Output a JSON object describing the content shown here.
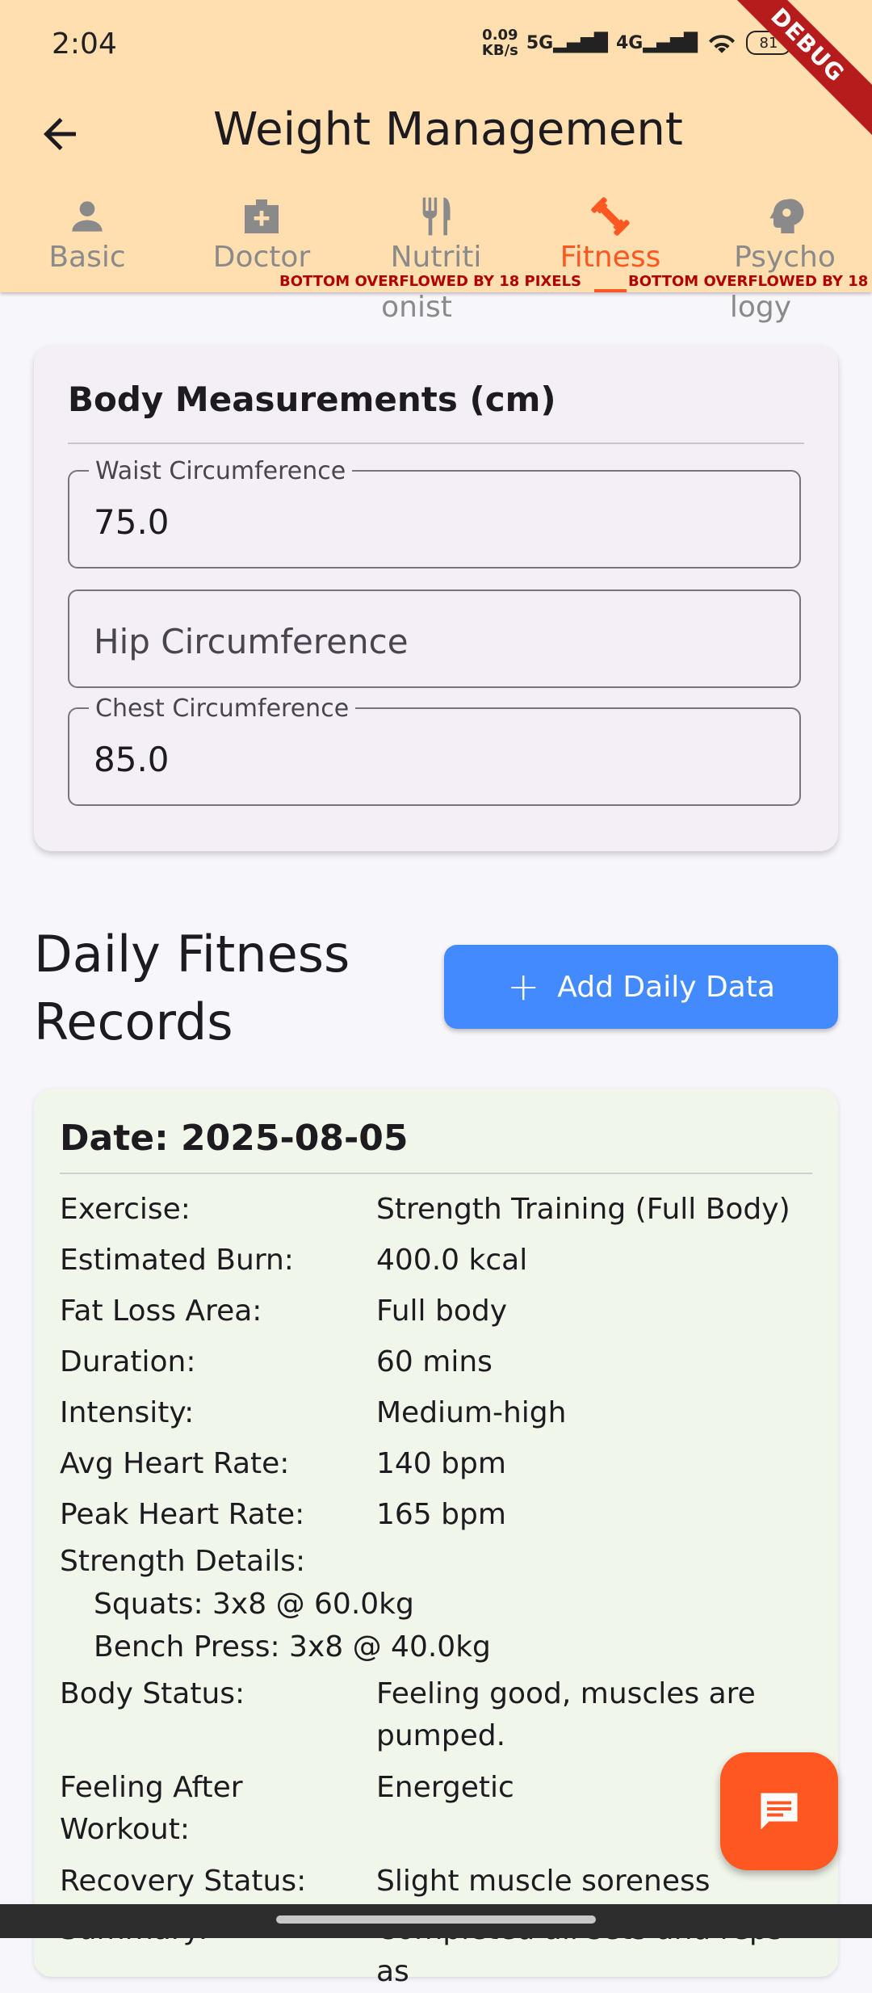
{
  "status": {
    "time": "2:04",
    "speed_top": "0.09",
    "speed_bottom": "KB/s",
    "net1": "5G",
    "net2": "4G",
    "battery": "81",
    "debug": "DEBUG"
  },
  "appbar": {
    "title": "Weight Management"
  },
  "tabs": [
    {
      "label": "Basic",
      "icon": "person-icon"
    },
    {
      "label": "Doctor",
      "icon": "medical-bag-icon"
    },
    {
      "label": "Nutriti",
      "label2": "onist",
      "icon": "fork-knife-icon"
    },
    {
      "label": "Fitness",
      "icon": "dumbbell-icon"
    },
    {
      "label": "Psycho",
      "label2": "logy",
      "icon": "head-gear-icon"
    }
  ],
  "overflow": {
    "text1": "BOTTOM OVERFLOWED BY 18 PIXELS",
    "text2": "BOTTOM OVERFLOWED BY 18"
  },
  "body_card": {
    "title": "Body Measurements (cm)",
    "waist_label": "Waist Circumference",
    "waist_value": "75.0",
    "hip_placeholder": "Hip Circumference",
    "chest_label": "Chest Circumference",
    "chest_value": "85.0"
  },
  "daily": {
    "title_line1": "Daily Fitness",
    "title_line2": "Records",
    "add_button": "Add Daily Data"
  },
  "record": {
    "date": "Date: 2025-08-05",
    "rows": [
      {
        "label": "Exercise:",
        "value": "Strength Training (Full Body)"
      },
      {
        "label": "Estimated Burn:",
        "value": "400.0 kcal"
      },
      {
        "label": "Fat Loss Area:",
        "value": "Full body"
      },
      {
        "label": "Duration:",
        "value": "60 mins"
      },
      {
        "label": "Intensity:",
        "value": "Medium-high"
      },
      {
        "label": "Avg Heart Rate:",
        "value": "140 bpm"
      },
      {
        "label": "Peak Heart Rate:",
        "value": "165 bpm"
      }
    ],
    "strength_label": "Strength Details:",
    "strength_items": [
      "Squats: 3x8 @ 60.0kg",
      "Bench Press: 3x8 @ 40.0kg"
    ],
    "body_status_label": "Body Status:",
    "body_status_value1": "Feeling good, muscles are",
    "body_status_value2": "pumped.",
    "feeling_label1": "Feeling After",
    "feeling_label2": "Workout:",
    "feeling_value": "Energetic",
    "recovery_label": "Recovery Status:",
    "recovery_value": "Slight muscle soreness",
    "summary_label": "Summary:",
    "summary_value": "Completed all sets and reps as"
  },
  "colors": {
    "appbar": "#ffdeb0",
    "accent": "#ff5722",
    "button": "#448aff"
  }
}
